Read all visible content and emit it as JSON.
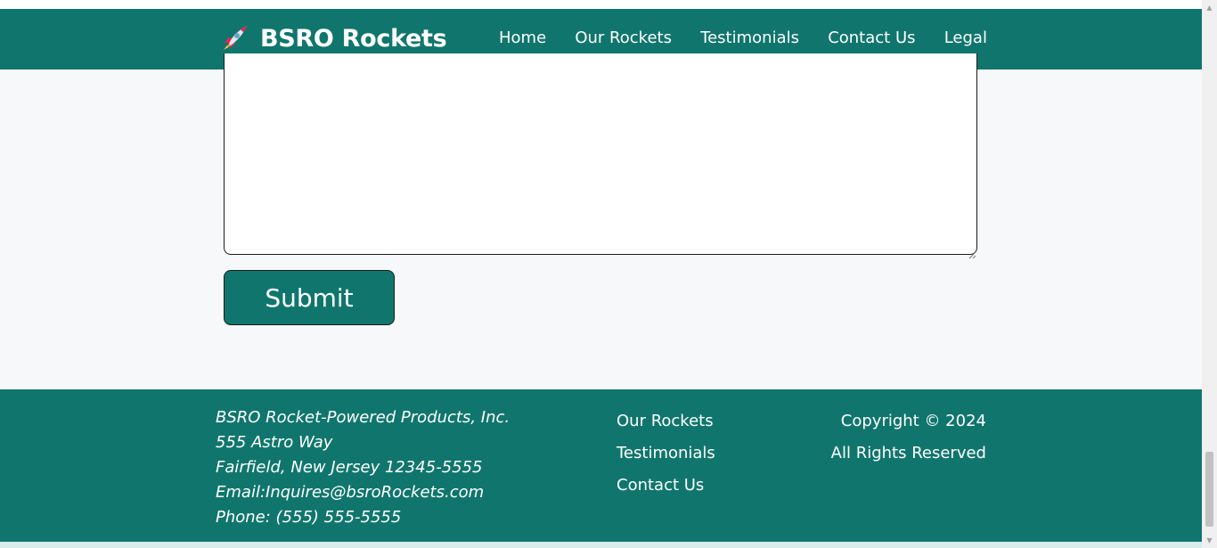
{
  "header": {
    "brand_name": "BSRO Rockets",
    "brand_icon": "rocket-icon",
    "nav": [
      {
        "label": "Home"
      },
      {
        "label": "Our Rockets"
      },
      {
        "label": "Testimonials"
      },
      {
        "label": "Contact Us"
      },
      {
        "label": "Legal"
      }
    ]
  },
  "form": {
    "message_value": "",
    "submit_label": "Submit"
  },
  "footer": {
    "address": {
      "company": "BSRO Rocket-Powered Products, Inc.",
      "street": "555 Astro Way",
      "city": "Fairfield, New Jersey 12345-5555",
      "email": "Email:Inquires@bsroRockets.com",
      "phone": "Phone: (555) 555-5555"
    },
    "links": [
      {
        "label": "Our Rockets"
      },
      {
        "label": "Testimonials"
      },
      {
        "label": "Contact Us"
      }
    ],
    "copyright": "Copyright © 2024",
    "rights": "All Rights Reserved"
  },
  "colors": {
    "primary": "#10766d",
    "page_background": "#f7f8fa",
    "text_on_primary": "#ffffff"
  }
}
